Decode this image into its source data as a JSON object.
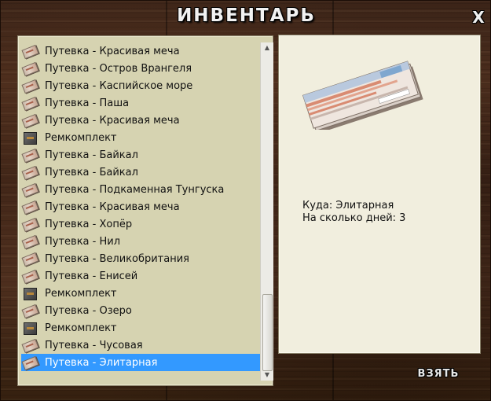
{
  "title": "ИНВЕНТАРЬ",
  "close_label": "X",
  "take_label": "ВЗЯТЬ",
  "items": [
    {
      "label": "Путевка - Красивая меча",
      "icon": "voucher-icon"
    },
    {
      "label": "Путевка - Остров Врангеля",
      "icon": "voucher-icon"
    },
    {
      "label": "Путевка - Каспийское море",
      "icon": "voucher-icon"
    },
    {
      "label": "Путевка - Паша",
      "icon": "voucher-icon"
    },
    {
      "label": "Путевка - Красивая меча",
      "icon": "voucher-icon"
    },
    {
      "label": "Ремкомплект",
      "icon": "repair-kit-icon"
    },
    {
      "label": "Путевка - Байкал",
      "icon": "voucher-icon"
    },
    {
      "label": "Путевка - Байкал",
      "icon": "voucher-icon"
    },
    {
      "label": "Путевка - Подкаменная Тунгуска",
      "icon": "voucher-icon"
    },
    {
      "label": "Путевка - Красивая меча",
      "icon": "voucher-icon"
    },
    {
      "label": "Путевка - Хопёр",
      "icon": "voucher-icon"
    },
    {
      "label": "Путевка - Нил",
      "icon": "voucher-icon"
    },
    {
      "label": "Путевка - Великобритания",
      "icon": "voucher-icon"
    },
    {
      "label": "Путевка - Енисей",
      "icon": "voucher-icon"
    },
    {
      "label": "Ремкомплект",
      "icon": "repair-kit-icon"
    },
    {
      "label": "Путевка - Озеро",
      "icon": "voucher-icon"
    },
    {
      "label": "Ремкомплект",
      "icon": "repair-kit-icon"
    },
    {
      "label": "Путевка - Чусовая",
      "icon": "voucher-icon"
    },
    {
      "label": "Путевка - Элитарная",
      "icon": "voucher-icon",
      "selected": true
    }
  ],
  "detail": {
    "destination": "Куда: Элитарная",
    "days": "На сколько дней: 3"
  },
  "colors": {
    "selection": "#3399ff",
    "list_bg": "#d6d3b1",
    "detail_bg": "#f1eede"
  }
}
